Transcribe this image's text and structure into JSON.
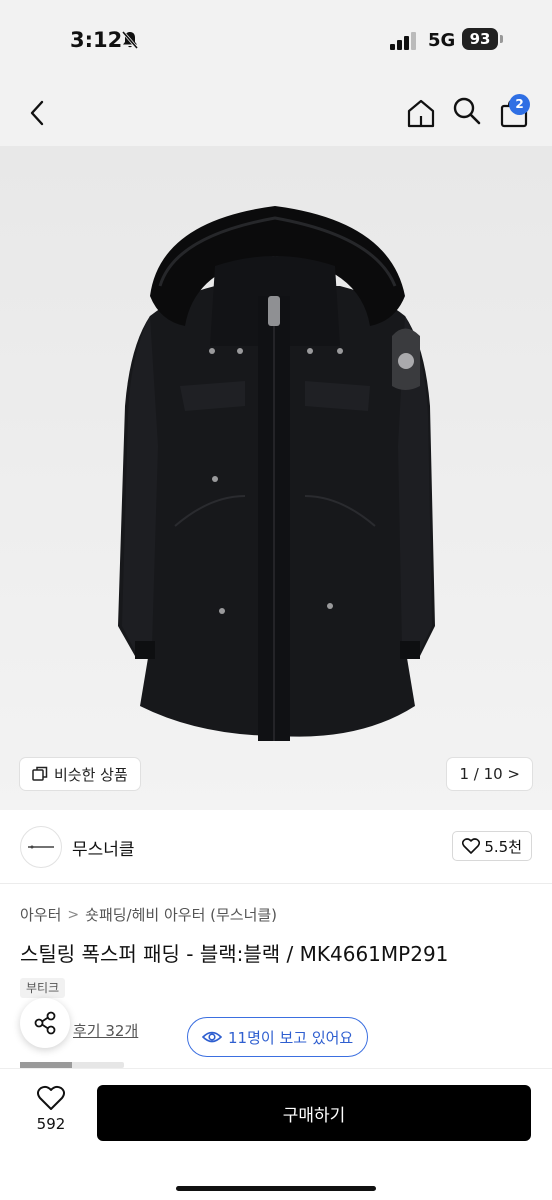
{
  "status_bar": {
    "time": "3:12",
    "network": "5G",
    "battery": "93",
    "icons": [
      "bell-slash-icon",
      "signal-icon"
    ]
  },
  "nav": {
    "icons": [
      "back-icon",
      "home-icon",
      "search-icon",
      "cart-icon"
    ],
    "cart_badge": "2",
    "accent_color": "#2f6fe4"
  },
  "product_image": {
    "similar_label": "비슷한 상품",
    "page_indicator": "1 / 10 >"
  },
  "brand": {
    "name": "무스너클",
    "likes": "5.5천"
  },
  "product": {
    "breadcrumb": [
      "아우터",
      "숏패딩/헤비 아우터 (무스너클)"
    ],
    "title": "스틸링 폭스퍼 패딩 - 블랙:블랙 / MK4661MP291",
    "tag": "부티크",
    "review_link": "후기 32개",
    "viewing_label": "11명이 보고 있어요"
  },
  "bottom_bar": {
    "wish_count": "592",
    "buy_label": "구매하기",
    "buy_color": "#000000"
  }
}
